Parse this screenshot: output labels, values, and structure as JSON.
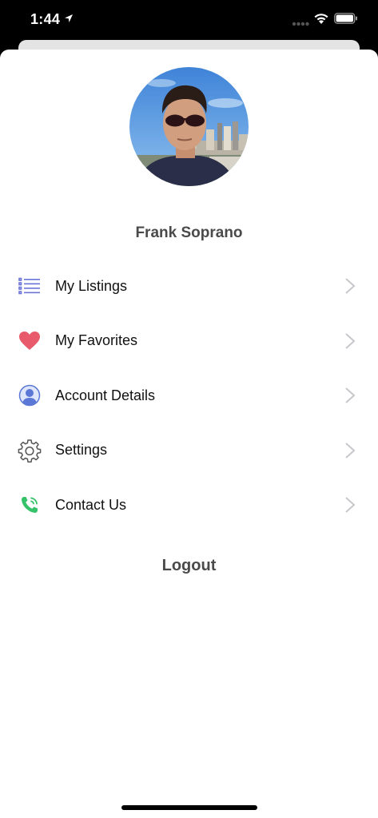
{
  "status_bar": {
    "time": "1:44"
  },
  "profile": {
    "name": "Frank Soprano"
  },
  "menu": {
    "items": [
      {
        "label": "My Listings",
        "icon": "list-icon"
      },
      {
        "label": "My Favorites",
        "icon": "heart-icon"
      },
      {
        "label": "Account Details",
        "icon": "user-icon"
      },
      {
        "label": "Settings",
        "icon": "gear-icon"
      },
      {
        "label": "Contact Us",
        "icon": "phone-icon"
      }
    ]
  },
  "logout_label": "Logout",
  "colors": {
    "list_icon": "#6b74d9",
    "heart_icon": "#e8596b",
    "user_icon": "#5b78d6",
    "gear_icon": "#555555",
    "phone_icon": "#35c26a",
    "chevron": "#c7c7cc",
    "text_muted": "#4a4a4a"
  }
}
